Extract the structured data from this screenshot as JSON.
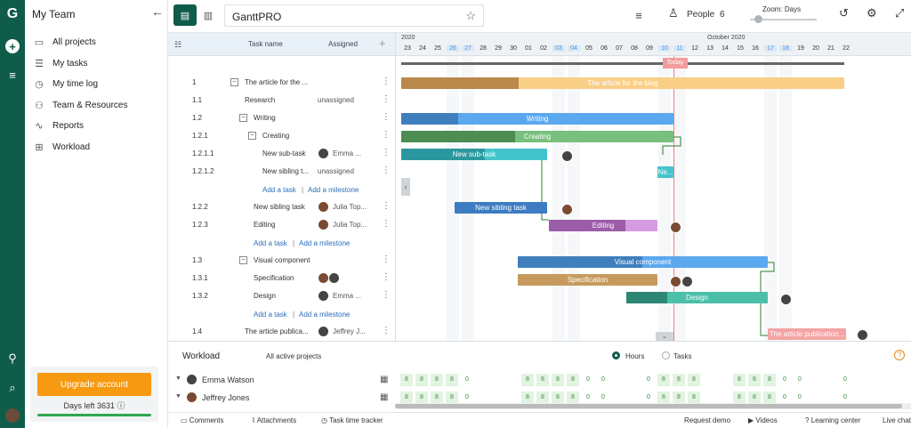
{
  "app": {
    "logo": "G",
    "colors": {
      "rail": "#0f5c4a",
      "accent": "#f79a12",
      "link": "#2a6ebb",
      "today": "#f08080"
    }
  },
  "sidebar": {
    "title": "My Team",
    "items": [
      {
        "label": "All projects",
        "icon": "folder-icon"
      },
      {
        "label": "My tasks",
        "icon": "list-icon"
      },
      {
        "label": "My time log",
        "icon": "clock-icon"
      },
      {
        "label": "Team & Resources",
        "icon": "team-icon"
      },
      {
        "label": "Reports",
        "icon": "chart-icon"
      },
      {
        "label": "Workload",
        "icon": "grid-icon"
      }
    ],
    "upgrade_label": "Upgrade account",
    "days_left": "Days left 3631"
  },
  "topbar": {
    "project_title": "GanttPRO",
    "people_label": "People",
    "people_count": "6",
    "zoom_label": "Zoom: Days"
  },
  "grid": {
    "header": {
      "task_name": "Task name",
      "assigned": "Assigned"
    },
    "rows": [
      {
        "num": "1",
        "name": "The article for the ...",
        "assign": ""
      },
      {
        "num": "1.1",
        "name": "Research",
        "assign": "unassigned"
      },
      {
        "num": "1.2",
        "name": "Writing",
        "assign": ""
      },
      {
        "num": "1.2.1",
        "name": "Creating",
        "assign": ""
      },
      {
        "num": "1.2.1.1",
        "name": "New sub-task",
        "assign": "Emma ..."
      },
      {
        "num": "1.2.1.2",
        "name": "New sibling t...",
        "assign": "unassigned"
      },
      {
        "num": "",
        "name": "",
        "assign": ""
      },
      {
        "num": "1.2.2",
        "name": "New sibling task",
        "assign": "Julia Top..."
      },
      {
        "num": "1.2.3",
        "name": "Editing",
        "assign": "Julia Top..."
      },
      {
        "num": "",
        "name": "",
        "assign": ""
      },
      {
        "num": "1.3",
        "name": "Visual component",
        "assign": ""
      },
      {
        "num": "1.3.1",
        "name": "Specification",
        "assign": ""
      },
      {
        "num": "1.3.2",
        "name": "Design",
        "assign": "Emma ..."
      },
      {
        "num": "",
        "name": "",
        "assign": ""
      },
      {
        "num": "1.4",
        "name": "The article publica...",
        "assign": "Jeffrey J..."
      }
    ],
    "add_task": "Add a task",
    "add_milestone": "Add a milestone"
  },
  "timeline": {
    "months": [
      "2020",
      "October 2020"
    ],
    "days": [
      "23",
      "24",
      "25",
      "26",
      "27",
      "28",
      "29",
      "30",
      "01",
      "02",
      "03",
      "04",
      "05",
      "06",
      "07",
      "08",
      "09",
      "10",
      "11",
      "12",
      "13",
      "14",
      "15",
      "16",
      "17",
      "18",
      "19",
      "20",
      "21",
      "22"
    ],
    "today_label": "Today",
    "bars": {
      "article": "The article for the blog",
      "writing": "Writing",
      "creating": "Creating",
      "subtask": "New sub-task",
      "sibling_short": "Ne...",
      "sibling": "New sibling task",
      "editing": "Editing",
      "visual": "Visual component",
      "spec": "Specification",
      "design": "Design",
      "publication": "The article publication..."
    }
  },
  "workload": {
    "title": "Workload",
    "filter": "All active projects",
    "hours": "Hours",
    "tasks": "Tasks",
    "rows": [
      {
        "name": "Emma Watson",
        "values": [
          "8",
          "8",
          "8",
          "8",
          "0",
          "",
          "",
          "",
          "8",
          "8",
          "8",
          "8",
          "0",
          "0",
          "",
          "",
          "0",
          "8",
          "8",
          "8",
          "",
          "",
          "8",
          "8",
          "8",
          "0",
          "0",
          "",
          "",
          "0"
        ]
      },
      {
        "name": "Jeffrey Jones",
        "values": [
          "8",
          "8",
          "8",
          "8",
          "0",
          "",
          "",
          "",
          "8",
          "8",
          "8",
          "8",
          "0",
          "0",
          "",
          "",
          "0",
          "8",
          "8",
          "8",
          "",
          "",
          "8",
          "8",
          "8",
          "0",
          "0",
          "",
          "",
          "0"
        ]
      }
    ]
  },
  "bottom": {
    "comments": "Comments",
    "attachments": "Attachments",
    "time_tracker": "Task time tracker",
    "request_demo": "Request demo",
    "videos": "Videos",
    "learning": "Learning center",
    "live_chat": "Live chat"
  }
}
